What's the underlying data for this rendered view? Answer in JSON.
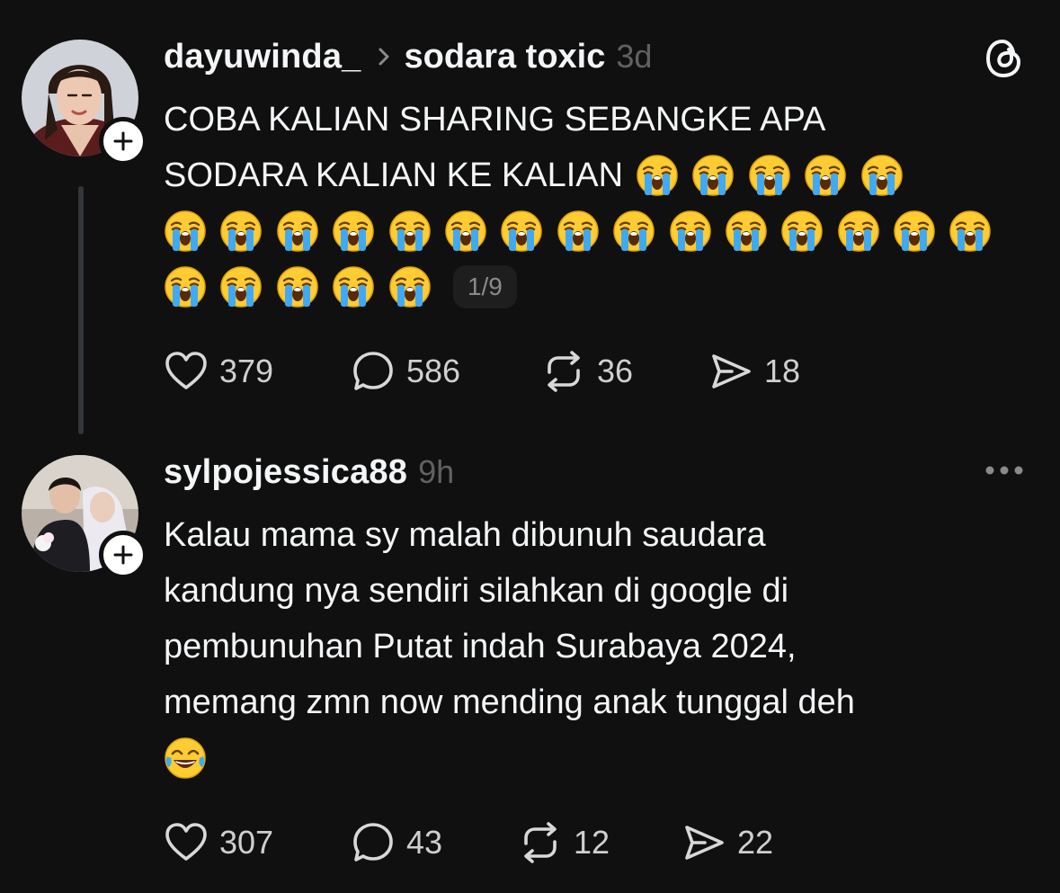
{
  "colors": {
    "background": "#101010",
    "text": "#f3f5f7",
    "muted": "#616161",
    "thread_line": "#333638"
  },
  "posts": [
    {
      "username": "dayuwinda_",
      "topic": "sodara toxic",
      "time": "3d",
      "lines": [
        "COBA KALIAN SHARING SEBANGKE APA",
        "SODARA KALIAN KE KALIAN"
      ],
      "emoji_name": "loudly-crying-face",
      "carousel_indicator": "1/9",
      "stats": {
        "likes": "379",
        "replies": "586",
        "reposts": "36",
        "shares": "18"
      }
    },
    {
      "username": "sylpojessica88",
      "time": "9h",
      "lines": [
        "Kalau mama sy malah dibunuh saudara",
        "kandung nya sendiri silahkan di google di",
        "pembunuhan Putat indah Surabaya 2024,",
        "memang zmn now mending anak tunggal deh"
      ],
      "emoji_name": "face-with-tears-of-joy",
      "stats": {
        "likes": "307",
        "replies": "43",
        "reposts": "12",
        "shares": "22"
      }
    }
  ]
}
